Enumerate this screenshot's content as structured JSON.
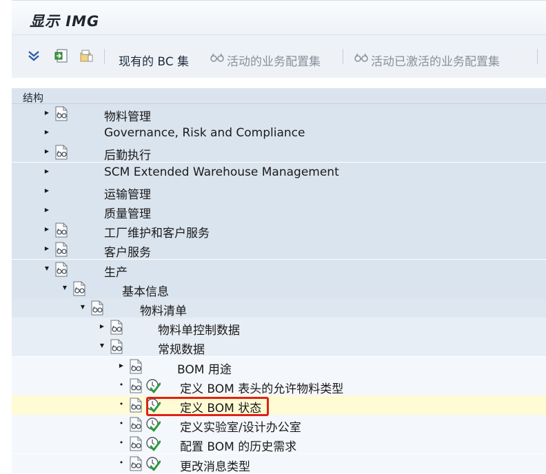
{
  "window": {
    "title": "显示 IMG"
  },
  "toolbar": {
    "bc_sets_label": "现有的 BC 集",
    "active_business_config_label": "活动的业务配置集",
    "activated_business_config_label": "活动已激活的业务配置集"
  },
  "structure": {
    "header": "结构",
    "items": [
      {
        "label": "物料管理",
        "state": "collapsed",
        "doc": true,
        "activity": false
      },
      {
        "label": "Governance, Risk and Compliance",
        "state": "collapsed",
        "doc": false,
        "activity": false
      },
      {
        "label": "后勤执行",
        "state": "collapsed",
        "doc": true,
        "activity": false
      },
      {
        "label": "SCM Extended Warehouse Management",
        "state": "collapsed",
        "doc": false,
        "activity": false
      },
      {
        "label": "运输管理",
        "state": "collapsed",
        "doc": false,
        "activity": false
      },
      {
        "label": "质量管理",
        "state": "collapsed",
        "doc": false,
        "activity": false
      },
      {
        "label": "工厂维护和客户服务",
        "state": "collapsed",
        "doc": true,
        "activity": false
      },
      {
        "label": "客户服务",
        "state": "collapsed",
        "doc": true,
        "activity": false
      },
      {
        "label": "生产",
        "state": "expanded",
        "doc": true,
        "activity": false
      },
      {
        "label": "基本信息",
        "state": "expanded",
        "doc": true,
        "activity": false
      },
      {
        "label": "物料清单",
        "state": "expanded",
        "doc": true,
        "activity": false
      },
      {
        "label": "物料单控制数据",
        "state": "collapsed",
        "doc": true,
        "activity": false
      },
      {
        "label": "常规数据",
        "state": "expanded",
        "doc": true,
        "activity": false
      },
      {
        "label": "BOM 用途",
        "state": "collapsed",
        "doc": true,
        "activity": false
      },
      {
        "label": "定义 BOM 表头的允许物料类型",
        "state": "leaf",
        "doc": true,
        "activity": true
      },
      {
        "label": "定义 BOM 状态",
        "state": "leaf",
        "doc": true,
        "activity": true,
        "selected": true
      },
      {
        "label": "定义实验室/设计办公室",
        "state": "leaf",
        "doc": true,
        "activity": true
      },
      {
        "label": "配置 BOM 的历史需求",
        "state": "leaf",
        "doc": true,
        "activity": true
      },
      {
        "label": "更改消息类型",
        "state": "leaf",
        "doc": true,
        "activity": true
      }
    ]
  },
  "colors": {
    "highlight_border": "#e0201a",
    "selected_row": "#fffbd4",
    "activity_icon_green": "#2a9a3a"
  },
  "icons": {
    "expand_all": "double-chevron-down-icon",
    "collapse": "collapse-subtree-icon",
    "folder": "folder-icon",
    "bc_set": "glasses-icon",
    "doc": "document-glasses-icon",
    "activity": "clock-check-icon"
  }
}
